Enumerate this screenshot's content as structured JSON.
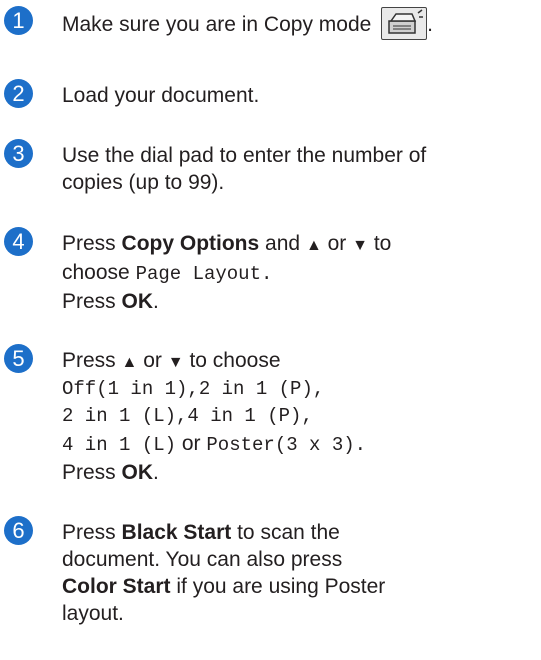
{
  "steps": [
    {
      "number": "1",
      "text": "Make sure you are in Copy mode",
      "trailing": "."
    },
    {
      "number": "2",
      "text": "Load your document."
    },
    {
      "number": "3",
      "line1": "Use the dial pad to enter the number of",
      "line2": "copies (up to 99)."
    },
    {
      "number": "4",
      "press": "Press",
      "copy_options": "Copy Options",
      "and": "and",
      "up": "▲",
      "or": "or",
      "down": "▼",
      "to": "to",
      "choose": "choose",
      "page_layout": "Page Layout.",
      "press_ok_prefix": "Press",
      "ok": "OK",
      "ok_suffix": "."
    },
    {
      "number": "5",
      "line1_press": "Press",
      "up": "▲",
      "or": "or",
      "down": "▼",
      "to_choose": "to choose",
      "opt_line1": "Off(1 in 1),2 in 1 (P),",
      "opt_line2": "2 in 1 (L),4 in 1 (P),",
      "opt_line3_a": "4 in 1 (L)",
      "opt_or": "or",
      "opt_line3_b": "Poster(3 x 3).",
      "press_ok_prefix": "Press",
      "ok": "OK",
      "ok_suffix": "."
    },
    {
      "number": "6",
      "press": "Press",
      "black_start": "Black Start",
      "to_scan": "to scan the",
      "line2": "document. You can also press",
      "color_start": "Color Start",
      "line3_rest": "if you are using Poster",
      "line4": "layout."
    }
  ]
}
